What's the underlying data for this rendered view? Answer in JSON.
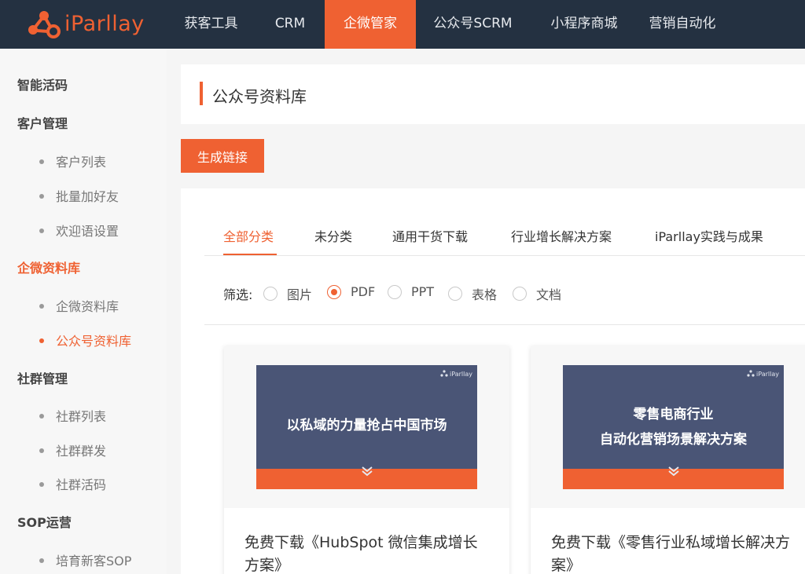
{
  "brand": {
    "name": "iParllay",
    "color": "#ef6132"
  },
  "nav": [
    {
      "label": "获客工具"
    },
    {
      "label": "CRM"
    },
    {
      "label": "企微管家",
      "active": true
    },
    {
      "label": "公众号SCRM"
    },
    {
      "label": "小程序商城"
    },
    {
      "label": "营销自动化"
    }
  ],
  "sidebar": {
    "groups": {
      "qr": "智能活码",
      "customer": "客户管理",
      "library": "企微资料库",
      "community": "社群管理",
      "sop": "SOP运营"
    },
    "items": {
      "customer_list": "客户列表",
      "batch_add": "批量加好友",
      "welcome": "欢迎语设置",
      "wecom_library": "企微资料库",
      "mp_library": "公众号资料库",
      "community_list": "社群列表",
      "community_broadcast": "社群群发",
      "community_qr": "社群活码",
      "nurture_sop": "培育新客SOP"
    }
  },
  "page": {
    "title": "公众号资料库",
    "generate_button": "生成链接"
  },
  "tabs": [
    {
      "label": "全部分类",
      "active": true
    },
    {
      "label": "未分类"
    },
    {
      "label": "通用干货下载"
    },
    {
      "label": "行业增长解决方案"
    },
    {
      "label": "iParllay实践与成果"
    }
  ],
  "filter": {
    "label": "筛选",
    "colon": ":",
    "options": [
      {
        "label": "图片",
        "checked": false
      },
      {
        "label": "PDF",
        "checked": true
      },
      {
        "label": "PPT",
        "checked": false
      },
      {
        "label": "表格",
        "checked": false
      },
      {
        "label": "文档",
        "checked": false
      }
    ]
  },
  "cards": [
    {
      "cover_lines": [
        "以私域的力量抢占中国市场"
      ],
      "cover_brand": "iParllay",
      "title": "免费下载《HubSpot 微信集成增长方案》"
    },
    {
      "cover_lines": [
        "零售电商行业",
        "自动化营销场景解决方案"
      ],
      "cover_brand": "iParllay",
      "title": "免费下载《零售行业私域增长解决方案》"
    }
  ],
  "colors": {
    "topbar": "#243141",
    "accent": "#ef6132",
    "cover": "#4a5576"
  }
}
